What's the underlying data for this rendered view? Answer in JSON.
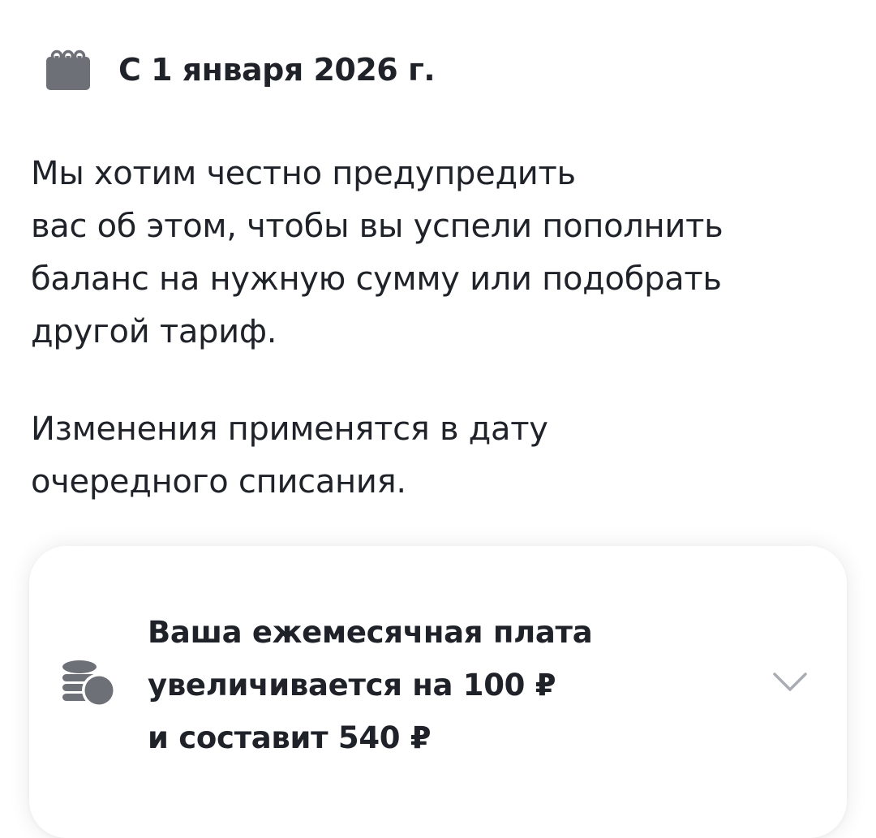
{
  "header": {
    "date_label": "С 1 января 2026 г.",
    "icon": "calendar-icon"
  },
  "notice": {
    "paragraph1": [
      "Мы хотим честно предупредить",
      "вас об этом, чтобы вы успели пополнить",
      "баланс на нужную сумму или подобрать",
      "другой тариф."
    ],
    "paragraph2": [
      "Изменения применятся в дату",
      "очередного списания."
    ]
  },
  "fee_card": {
    "icon": "coins-icon",
    "lines": [
      "Ваша ежемесячная плата",
      "увеличивается на 100 ₽",
      "и составит 540 ₽"
    ],
    "expand_icon": "chevron-down-icon"
  },
  "colors": {
    "text": "#1f2229",
    "icon": "#6e7078",
    "chevron": "#a9acb3",
    "card_background": "#ffffff"
  }
}
